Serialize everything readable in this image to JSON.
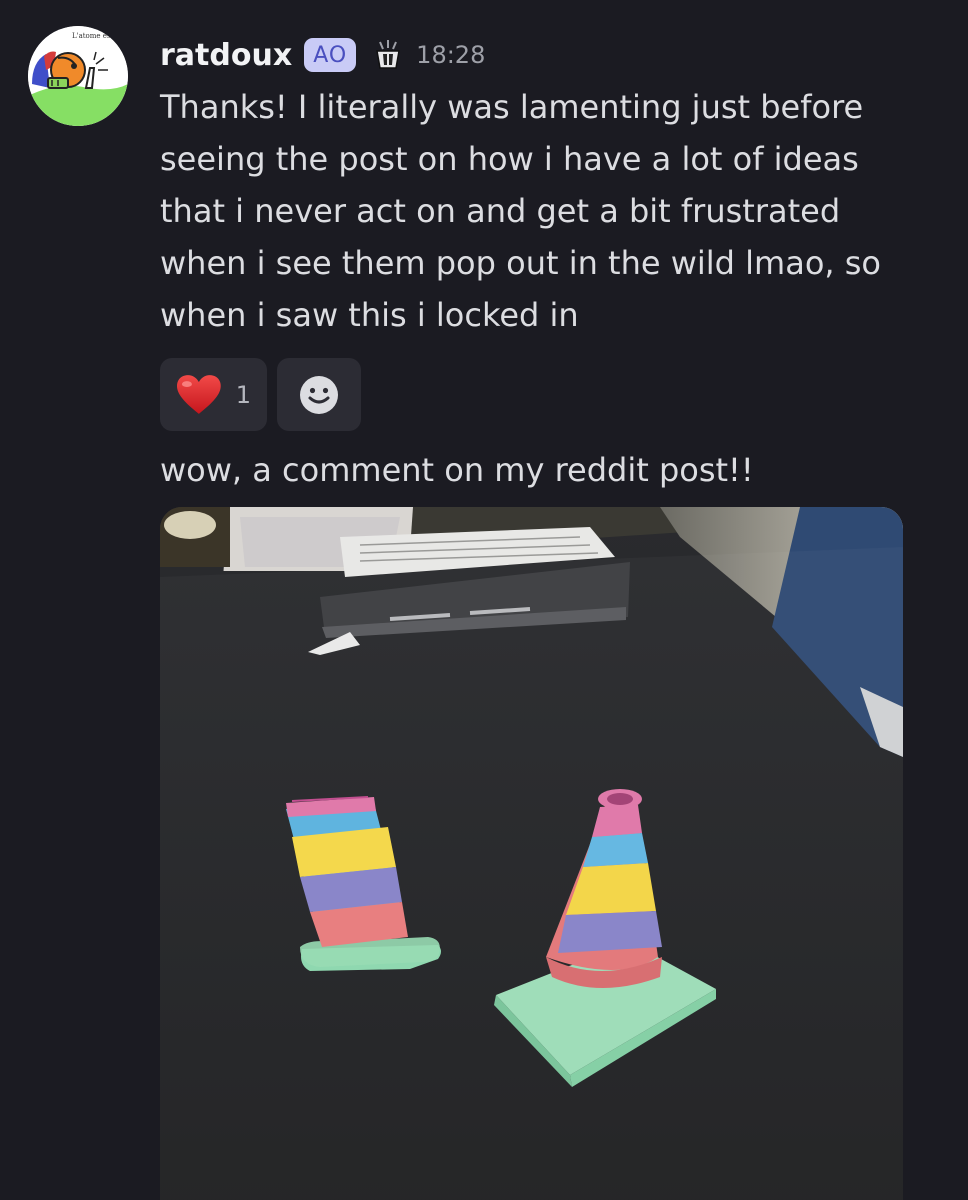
{
  "message": {
    "avatar_caption": "L'atome est",
    "username": "ratdoux",
    "server_tag": "AO",
    "timestamp": "18:28",
    "body_lines": [
      "Thanks! I literally was lamenting just before",
      "seeing the post on how i have a lot of ideas",
      "that i never act on and get a bit frustrated",
      "when i see them pop out in the wild lmao, so",
      "when i saw this i locked in"
    ],
    "reactions": [
      {
        "emoji": "heart-icon",
        "count": "1"
      }
    ],
    "add_reaction_icon": "smiley-icon",
    "followup": "wow, a comment on my reddit post!!",
    "attachment_icon": "photo-of-3d-printed-traffic-cones"
  },
  "colors": {
    "background": "#1b1b22",
    "username": "#f2f3f5",
    "text": "#dcdde1",
    "timestamp": "#9ea0a8",
    "reaction_bg": "#2c2c34",
    "tag_bg": "#c9cbf6",
    "tag_text": "#4a4fbf"
  }
}
